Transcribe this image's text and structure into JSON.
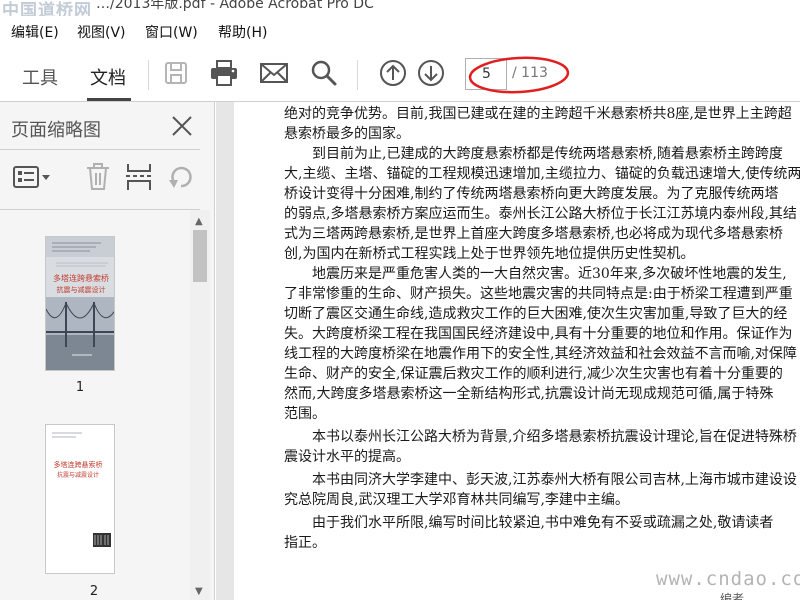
{
  "window": {
    "title": "…/2013年版.pdf - Adobe Acrobat Pro DC",
    "watermark_top": "中国道桥网"
  },
  "menu": [
    {
      "label": "编辑(E)"
    },
    {
      "label": "视图(V)"
    },
    {
      "label": "窗口(W)"
    },
    {
      "label": "帮助(H)"
    }
  ],
  "toolbar": {
    "tab_tools": "工具",
    "tab_documents": "文档",
    "icons": [
      "save-icon",
      "print-icon",
      "email-icon",
      "search-icon",
      "page-up-icon",
      "page-down-icon"
    ],
    "page_current": "5",
    "page_total": "/ 113",
    "highlight_color": "#e02020"
  },
  "sidepanel": {
    "title": "页面缩略图",
    "icons": [
      "thumbnail-options-icon",
      "delete-page-icon",
      "insert-page-icon",
      "rotate-page-icon"
    ],
    "thumbnails": [
      {
        "label": "1",
        "cover_title": "多塔连跨悬索桥",
        "cover_subtitle": "抗震与减震设计"
      },
      {
        "label": "2",
        "cover_title": "多塔连跨悬索桥",
        "cover_subtitle": "抗震与减震设计"
      }
    ]
  },
  "document": {
    "lines": [
      "绝对的竞争优势。目前,我国已建或在建的主跨超千米悬索桥共8座,是世界上主跨超",
      "悬索桥最多的国家。",
      "　　到目前为止,已建成的大跨度悬索桥都是传统两塔悬索桥,随着悬索桥主跨跨度",
      "大,主缆、主塔、锚碇的工程规模迅速增加,主缆拉力、锚碇的负载迅速增大,使传统两塔",
      "桥设计变得十分困难,制约了传统两塔悬索桥向更大跨度发展。为了克服传统两塔",
      "的弱点,多塔悬索桥方案应运而生。泰州长江公路大桥位于长江江苏境内泰州段,其结",
      "式为三塔两跨悬索桥,是世界上首座大跨度多塔悬索桥,也必将成为现代多塔悬索桥",
      "创,为国内在新桥式工程实践上处于世界领先地位提供历史性契机。",
      "　　地震历来是严重危害人类的一大自然灾害。近30年来,多次破坏性地震的发生,",
      "了非常惨重的生命、财产损失。这些地震灾害的共同特点是:由于桥梁工程遭到严重",
      "切断了震区交通生命线,造成救灾工作的巨大困难,使次生灾害加重,导致了巨大的经",
      "失。大跨度桥梁工程在我国国民经济建设中,具有十分重要的地位和作用。保证作为",
      "线工程的大跨度桥梁在地震作用下的安全性,其经济效益和社会效益不言而喻,对保障",
      "生命、财产的安全,保证震后救灾工作的顺利进行,减少次生灾害也有着十分重要的",
      "然而,大跨度多塔悬索桥这一全新结构形式,抗震设计尚无现成规范可循,属于特殊",
      "范围。",
      "　　本书以泰州长江公路大桥为背景,介绍多塔悬索桥抗震设计理论,旨在促进特殊桥",
      "震设计水平的提高。",
      "　　本书由同济大学李建中、彭天波,江苏泰州大桥有限公司吉林,上海市城市建设设",
      "究总院周良,武汉理工大学邓育林共同编写,李建中主编。",
      "　　由于我们水平所限,编写时间比较紧迫,书中难免有不妥或疏漏之处,敬请读者",
      "指正。"
    ],
    "watermark_bottom": "www.cndao.com",
    "bottom_cut_text": "编者"
  }
}
